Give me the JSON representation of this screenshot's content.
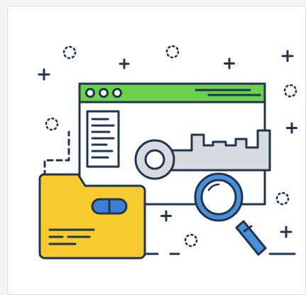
{
  "illustration": {
    "subject": "key-search",
    "colors": {
      "outline": "#1f3550",
      "browser_bar": "#6ad14a",
      "folder": "#f7cb2d",
      "key": "#d7dbe0",
      "lens_ring": "#4a90d9",
      "folder_badge": "#3b7fd6",
      "background": "#ffffff"
    },
    "icons": [
      "browser-window-icon",
      "document-icon",
      "key-icon",
      "folder-icon",
      "magnifier-icon",
      "sparkle-icon",
      "plus-icon"
    ]
  }
}
